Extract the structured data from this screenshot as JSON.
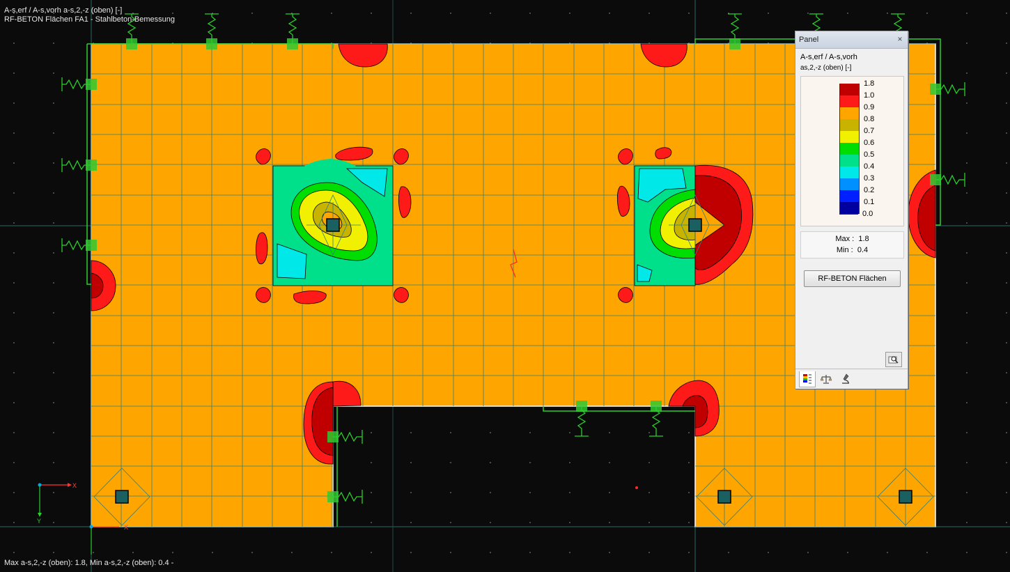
{
  "overlay": {
    "line1": "A-s,erf / A-s,vorh a-s,2,-z (oben) [-]",
    "line2": "RF-BETON Flächen FA1 - Stahlbeton-Bemessung",
    "status": "Max a-s,2,-z (oben): 1.8, Min a-s,2,-z (oben): 0.4 -"
  },
  "axes": {
    "x": "X",
    "y": "Y"
  },
  "panel": {
    "title": "Panel",
    "close": "×",
    "heading": "A-s,erf / A-s,vorh",
    "subheading": "as,2,-z (oben) [-]",
    "legend": [
      {
        "label": "1.8",
        "color": "#c00000"
      },
      {
        "label": "1.0",
        "color": "#ff1a1a"
      },
      {
        "label": "0.9",
        "color": "#ffa500"
      },
      {
        "label": "0.8",
        "color": "#c8b400"
      },
      {
        "label": "0.7",
        "color": "#f0f000"
      },
      {
        "label": "0.6",
        "color": "#00dd00"
      },
      {
        "label": "0.5",
        "color": "#00e08a"
      },
      {
        "label": "0.4",
        "color": "#00e8e8"
      },
      {
        "label": "0.3",
        "color": "#0090ff"
      },
      {
        "label": "0.2",
        "color": "#0020ff"
      },
      {
        "label": "0.1",
        "color": "#0000a0"
      },
      {
        "label": "0.0",
        "color": ""
      }
    ],
    "max_label": "Max",
    "max_value": "1.8",
    "min_label": "Min",
    "min_value": "0.4",
    "button": "RF-BETON Flächen",
    "tabs": [
      "color-scale-icon",
      "balance-icon",
      "microscope-icon"
    ]
  }
}
